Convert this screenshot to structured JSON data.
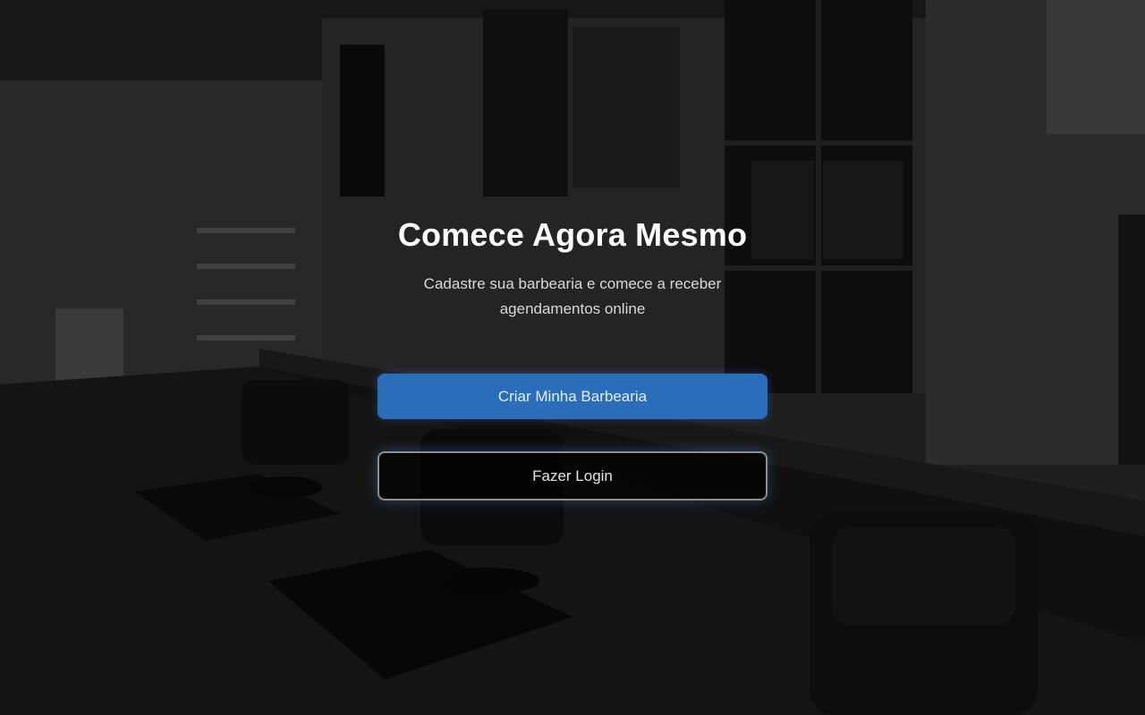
{
  "hero": {
    "title": "Comece Agora Mesmo",
    "subtitle": "Cadastre sua barbearia e comece a receber agendamentos online"
  },
  "actions": {
    "create_label": "Criar Minha Barbearia",
    "login_label": "Fazer Login"
  },
  "colors": {
    "primary": "#2a6db8",
    "overlay": "#000000",
    "title": "#ffffff"
  },
  "background": {
    "icon": "barbershop-interior-photo"
  }
}
